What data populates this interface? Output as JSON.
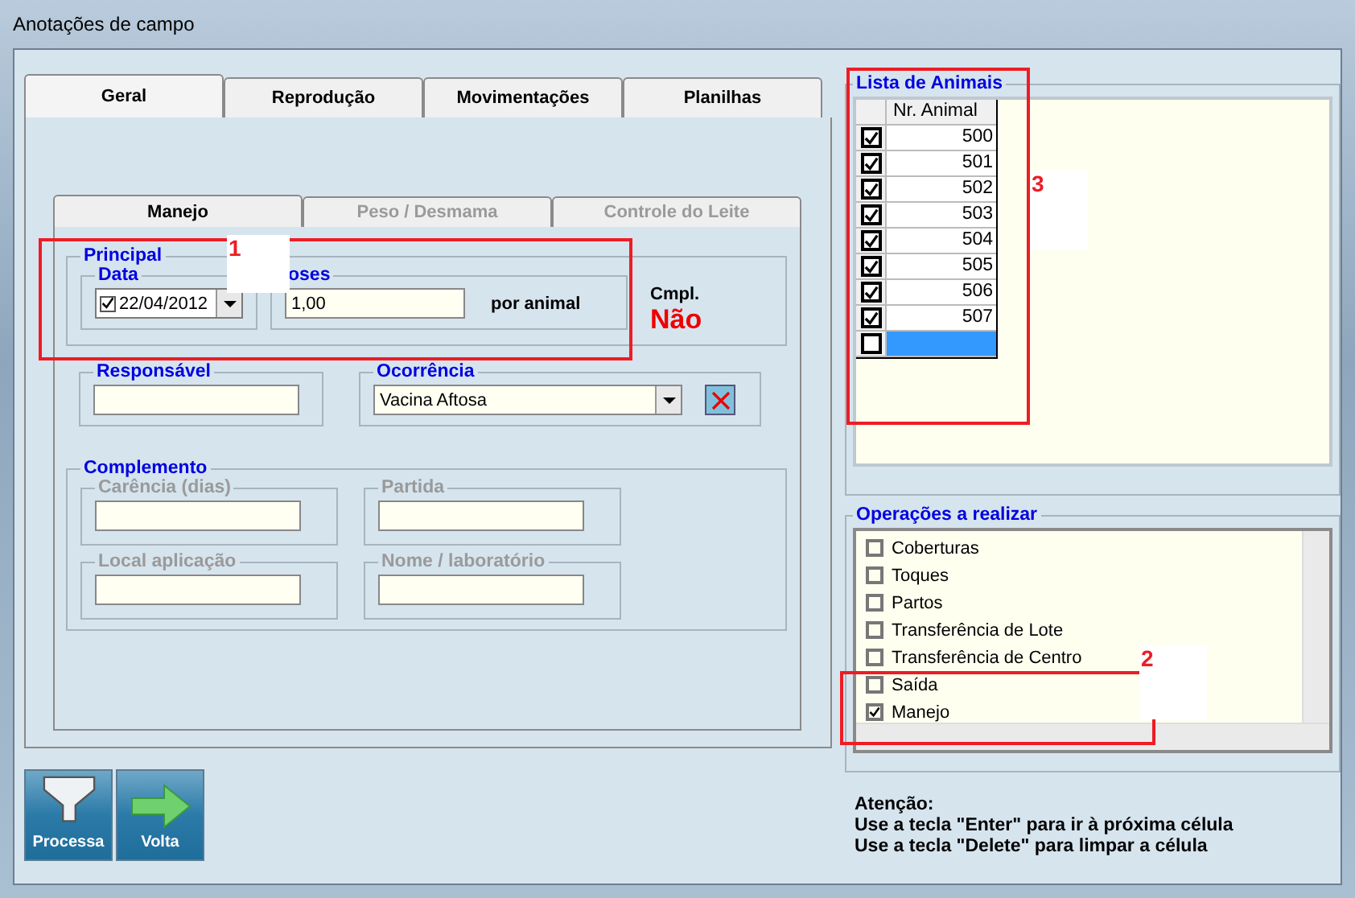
{
  "window": {
    "title": "Anotações de campo"
  },
  "tabs": [
    {
      "label": "Geral",
      "selected": true
    },
    {
      "label": "Reprodução",
      "selected": false
    },
    {
      "label": "Movimentações",
      "selected": false
    },
    {
      "label": "Planilhas",
      "selected": false
    }
  ],
  "subtabs": [
    {
      "label": "Manejo",
      "selected": true,
      "disabled": false
    },
    {
      "label": "Peso / Desmama",
      "selected": false,
      "disabled": true
    },
    {
      "label": "Controle do Leite",
      "selected": false,
      "disabled": true
    }
  ],
  "principal": {
    "title": "Principal",
    "data": {
      "label": "Data",
      "value": "22/04/2012",
      "checked": true
    },
    "doses": {
      "label": "oses",
      "value": "1,00",
      "unit": "por animal"
    },
    "cmpl": {
      "label": "Cmpl.",
      "value": "Não"
    }
  },
  "responsavel": {
    "label": "Responsável"
  },
  "ocorrencia": {
    "label": "Ocorrência",
    "value": "Vacina Aftosa"
  },
  "complemento": {
    "title": "Complemento",
    "fields": [
      {
        "label": "Carência (dias)",
        "disabled": true
      },
      {
        "label": "Partida",
        "disabled": true
      },
      {
        "label": "Local aplicação",
        "disabled": true
      },
      {
        "label": "Nome / laboratório",
        "disabled": true
      }
    ]
  },
  "animals": {
    "title": "Lista de Animais",
    "column": "Nr. Animal",
    "rows": [
      {
        "number": "500",
        "checked": true
      },
      {
        "number": "501",
        "checked": true
      },
      {
        "number": "502",
        "checked": true
      },
      {
        "number": "503",
        "checked": true
      },
      {
        "number": "504",
        "checked": true
      },
      {
        "number": "505",
        "checked": true
      },
      {
        "number": "506",
        "checked": true
      },
      {
        "number": "507",
        "checked": true
      },
      {
        "number": "",
        "checked": false,
        "selected": true
      }
    ]
  },
  "operations": {
    "title": "Operações a realizar",
    "items": [
      {
        "label": "Coberturas",
        "checked": false
      },
      {
        "label": "Toques",
        "checked": false
      },
      {
        "label": "Partos",
        "checked": false
      },
      {
        "label": "Transferência de Lote",
        "checked": false
      },
      {
        "label": "Transferência de Centro",
        "checked": false
      },
      {
        "label": "Saída",
        "checked": false
      },
      {
        "label": "Manejo",
        "checked": true
      }
    ]
  },
  "buttons": [
    {
      "label": "Processa",
      "kind": "funnel"
    },
    {
      "label": "Volta",
      "kind": "arrow"
    }
  ],
  "attention": {
    "title": "Atenção:",
    "lines": [
      "Use a tecla \"Enter\" para ir à próxima célula",
      "Use a tecla \"Delete\" para limpar a célula"
    ]
  },
  "annotations": [
    {
      "number": "1"
    },
    {
      "number": "2"
    },
    {
      "number": "3"
    }
  ]
}
